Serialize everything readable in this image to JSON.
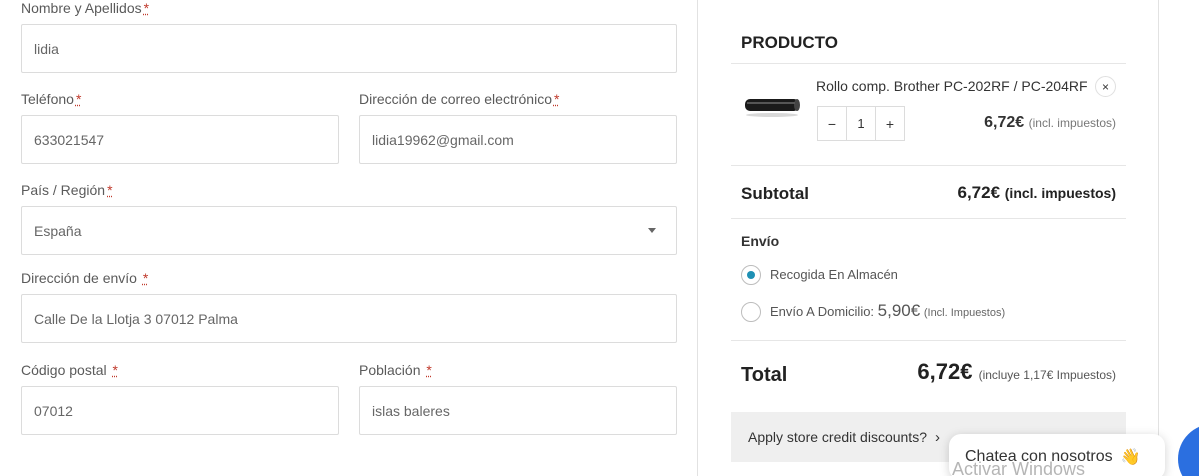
{
  "form": {
    "nombre": {
      "label": "Nombre y Apellidos",
      "required": "*",
      "value": "lidia"
    },
    "telefono": {
      "label": "Teléfono",
      "required": "*",
      "value": "633021547"
    },
    "email": {
      "label": "Dirección de correo electrónico",
      "required": "*",
      "value": "lidia19962@gmail.com"
    },
    "pais": {
      "label": "País / Región",
      "required": "*",
      "value": "España"
    },
    "direccion": {
      "label": "Dirección de envío",
      "required": "*",
      "value": "Calle De la Llotja 3 07012 Palma"
    },
    "cp": {
      "label": "Código postal",
      "required": "*",
      "value": "07012"
    },
    "poblacion": {
      "label": "Población",
      "required": "*",
      "value": "islas baleres"
    }
  },
  "summary": {
    "heading": "PRODUCTO",
    "product": {
      "name": "Rollo comp. Brother PC-202RF / PC-204RF",
      "remove_glyph": "×",
      "qty_minus": "−",
      "qty_value": "1",
      "qty_plus": "+",
      "price": "6,72€",
      "price_note": "(incl. impuestos)"
    },
    "subtotal_label": "Subtotal",
    "subtotal_value": "6,72€",
    "subtotal_note": "(incl. impuestos)",
    "envio_label": "Envío",
    "shipping_options": [
      {
        "label": "Recogida En Almacén",
        "selected": true
      },
      {
        "label": "Envío A Domicilio:",
        "price": "5,90€",
        "note": "(Incl. Impuestos)",
        "selected": false
      }
    ],
    "total_label": "Total",
    "total_value": "6,72€",
    "total_note": "(incluye 1,17€ Impuestos)",
    "credit_label": "Apply store credit discounts?",
    "credit_chevron": "›"
  },
  "chat": {
    "text": "Chatea con nosotros",
    "wave": "👋"
  },
  "watermark": "Activar Windows",
  "colors": {
    "radio_selected": "#1e90b4",
    "required_mark": "#c0392b",
    "chat_button": "#2b6fe0"
  }
}
